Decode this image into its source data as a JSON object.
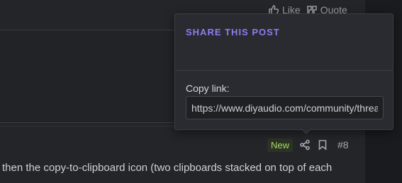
{
  "post_actions": {
    "like_label": "Like",
    "quote_label": "Quote"
  },
  "share_popover": {
    "title": "SHARE THIS POST",
    "copy_label": "Copy link:",
    "copy_value": "https://www.diyaudio.com/community/threa"
  },
  "post": {
    "badge": "New",
    "number": "#8",
    "body_text": " then the copy-to-clipboard icon (two clipboards stacked on top of each"
  },
  "icons": {
    "like": "thumbs-up-icon",
    "quote": "quote-icon",
    "share": "share-icon",
    "bookmark": "bookmark-icon"
  },
  "colors": {
    "accent": "#8f7cf0",
    "new_badge": "#a6d96a",
    "background": "#242529"
  }
}
